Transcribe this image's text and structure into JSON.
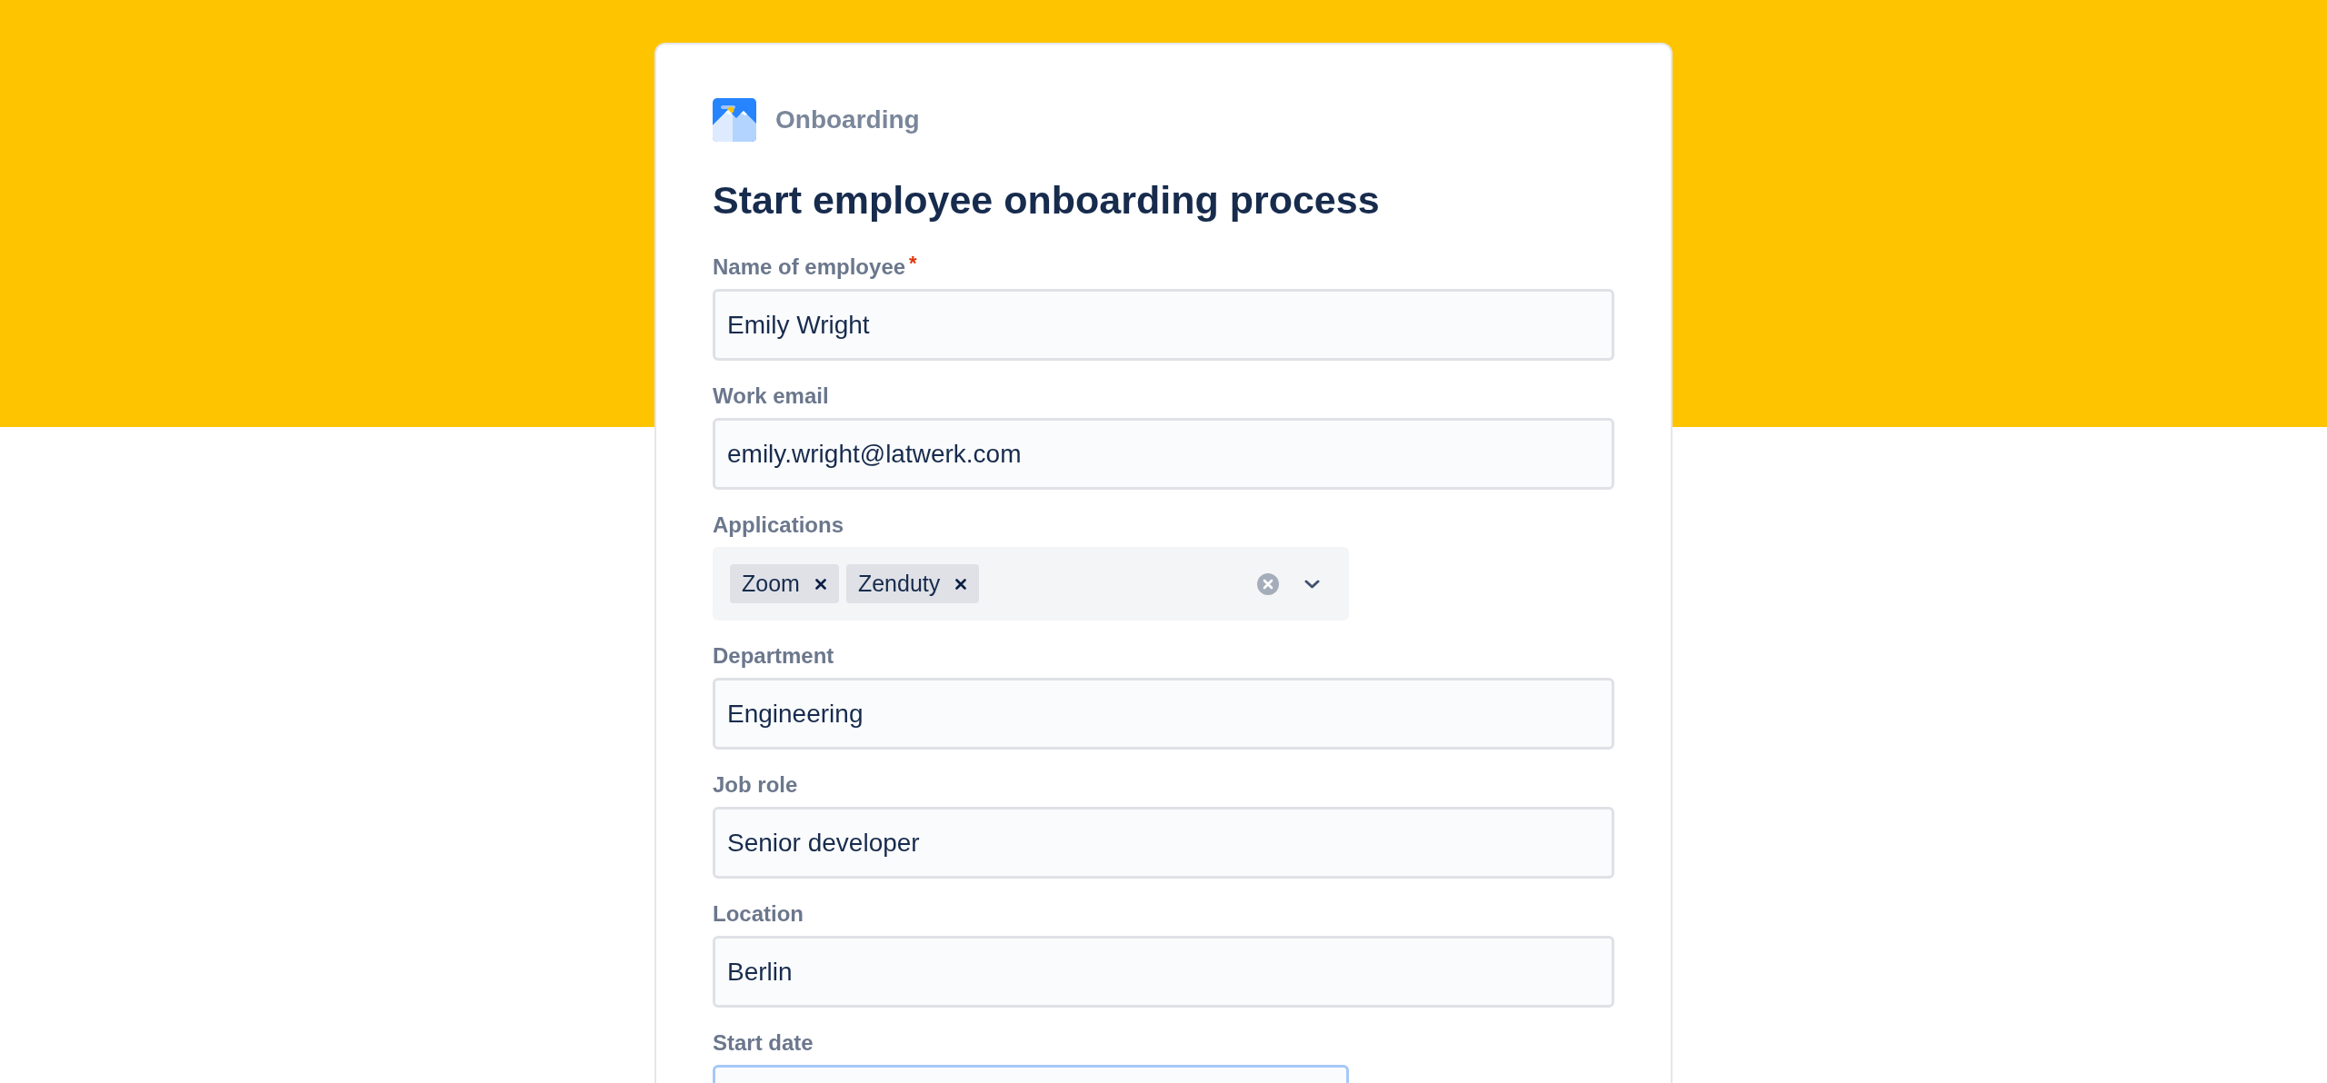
{
  "header": {
    "app_name": "Onboarding"
  },
  "form": {
    "title": "Start employee onboarding process",
    "required_mark": "*",
    "fields": [
      {
        "kind": "text",
        "label": "Name of employee",
        "required": true,
        "value": "Emily Wright",
        "focused": false
      },
      {
        "kind": "text",
        "label": "Work email",
        "required": false,
        "value": "emily.wright@latwerk.com",
        "focused": false
      },
      {
        "kind": "select",
        "label": "Applications",
        "required": false,
        "tags": [
          "Zoom",
          "Zenduty"
        ],
        "focused": false
      },
      {
        "kind": "text",
        "label": "Department",
        "required": false,
        "value": "Engineering",
        "focused": false
      },
      {
        "kind": "text",
        "label": "Job role",
        "required": false,
        "value": "Senior developer",
        "focused": false
      },
      {
        "kind": "text",
        "label": "Location",
        "required": false,
        "value": "Berlin",
        "focused": false
      },
      {
        "kind": "date",
        "label": "Start date",
        "required": false,
        "focused": true
      }
    ]
  }
}
